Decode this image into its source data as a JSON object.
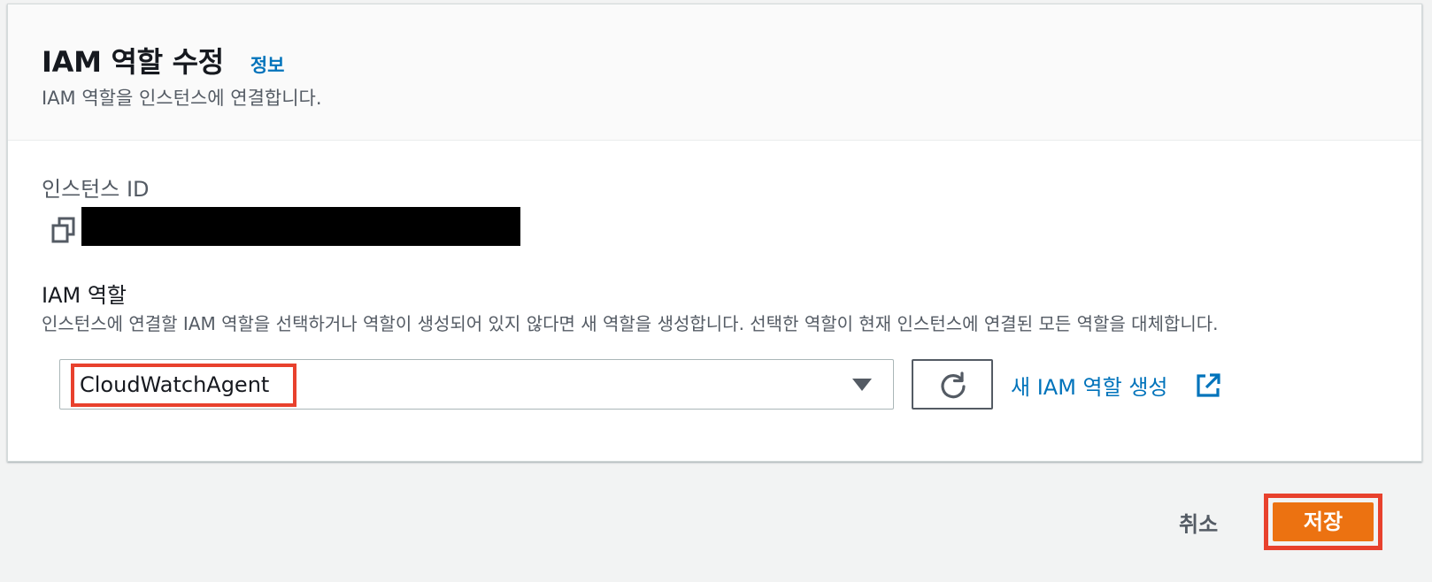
{
  "header": {
    "title": "IAM 역할 수정",
    "info_link": "정보",
    "subtitle": "IAM 역할을 인스턴스에 연결합니다."
  },
  "instance": {
    "label": "인스턴스 ID"
  },
  "iam_role": {
    "label": "IAM 역할",
    "description": "인스턴스에 연결할 IAM 역할을 선택하거나 역할이 생성되어 있지 않다면 새 역할을 생성합니다. 선택한 역할이 현재 인스턴스에 연결된 모든 역할을 대체합니다.",
    "selected_value": "CloudWatchAgent",
    "create_link": "새 IAM 역할 생성"
  },
  "footer": {
    "cancel_label": "취소",
    "save_label": "저장"
  },
  "icons": {
    "copy": "copy-icon",
    "refresh": "refresh-icon",
    "external_link": "external-link-icon",
    "caret": "caret-down-icon"
  },
  "colors": {
    "link": "#0073bb",
    "primary_button": "#ec7211",
    "highlight": "#e8412d"
  }
}
